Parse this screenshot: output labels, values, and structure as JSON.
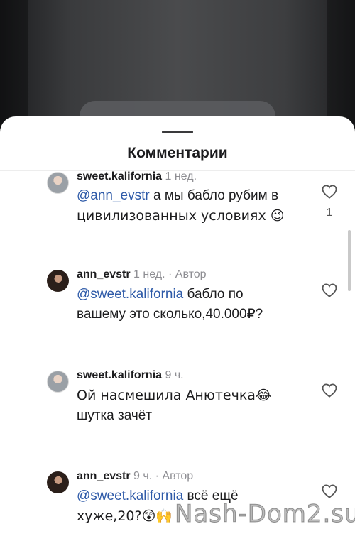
{
  "sheet": {
    "title": "Комментарии"
  },
  "comments": [
    {
      "username": "sweet.kalifornia",
      "time": "1 нед.",
      "author_badge": "",
      "mention": "@ann_evstr",
      "text_line1": " а мы бабло рубим в",
      "text_line2": "цивилизованных условиях 😉",
      "likes": "1"
    },
    {
      "username": "ann_evstr",
      "time": "1 нед.",
      "author_badge": "· Автор",
      "mention": "@sweet.kalifornia",
      "text_line1": " бабло по",
      "text_line2": "вашему это сколько,40.000₽?",
      "likes": ""
    },
    {
      "username": "sweet.kalifornia",
      "time": "9 ч.",
      "author_badge": "",
      "mention": "",
      "text_line1": "Ой насмешила Анютечка😂",
      "text_line2": "шутка зачёт",
      "likes": ""
    },
    {
      "username": "ann_evstr",
      "time": "9 ч.",
      "author_badge": "· Автор",
      "mention": "@sweet.kalifornia",
      "text_line1": " всё ещё",
      "text_line2": "хуже,20?😲🙌",
      "likes": ""
    }
  ],
  "watermark": "Nash-Dom2.su",
  "icons": {
    "like": "heart-outline-icon"
  },
  "colors": {
    "mention": "#2e5aa8",
    "muted": "#8e8e93",
    "sheet_bg": "#ffffff"
  }
}
